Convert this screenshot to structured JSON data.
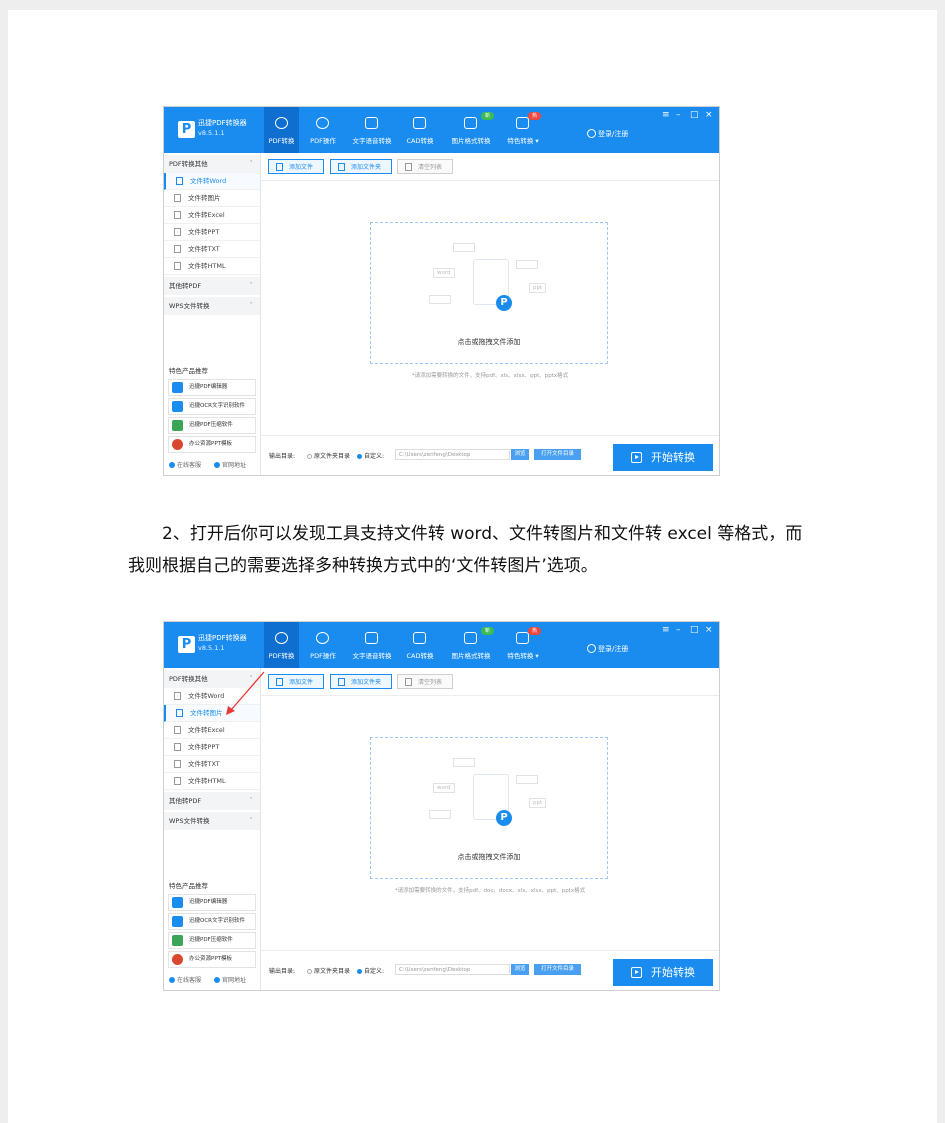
{
  "paragraph": {
    "line1": "2、打开后你可以发现工具支持文件转 word、文件转图片和文件转 excel 等格式，而",
    "line2": "我则根据自己的需要选择多种转换方式中的‘文件转图片’选项。"
  },
  "app": {
    "name": "迅捷PDF转换器",
    "version": "v8.5.1.1",
    "logo_letter": "P",
    "nav": [
      {
        "label": "PDF转换",
        "icon": "refresh-icon",
        "active": true
      },
      {
        "label": "PDF操作",
        "icon": "gear-icon"
      },
      {
        "label": "文字语音转换",
        "icon": "audio-icon"
      },
      {
        "label": "CAD转换",
        "icon": "cad-icon"
      },
      {
        "label": "图片格式转换",
        "icon": "image-icon",
        "badge": "新"
      },
      {
        "label": "特色转换 ▾",
        "icon": "camera-icon",
        "badge": "热"
      }
    ],
    "login": "登录/注册",
    "window_controls": [
      "≡",
      "–",
      "□",
      "×"
    ],
    "sidebar": {
      "section1": "PDF转换其他",
      "items": [
        "文件转Word",
        "文件转图片",
        "文件转Excel",
        "文件转PPT",
        "文件转TXT",
        "文件转HTML"
      ],
      "section2": "其他转PDF",
      "section3": "WPS文件转换",
      "featured_title": "特色产品推荐",
      "products": [
        "迅捷PDF编辑器",
        "迅捷OCR文字识别软件",
        "迅捷PDF压缩软件",
        "办公资源PPT模板"
      ],
      "footer_left": "在线客服",
      "footer_right": "官网地址"
    },
    "toolbar": {
      "add_file": "添加文件",
      "add_folder": "添加文件夹",
      "clear_list": "清空列表"
    },
    "dropzone": {
      "text": "点击或拖拽文件添加",
      "chips": [
        "word",
        "ppt"
      ]
    },
    "bottom": {
      "output_label": "输出目录:",
      "source_dir": "原文件夹目录",
      "custom": "自定义:",
      "path": "C:\\Users\\zenfeng\\Desktop",
      "browse": "浏览",
      "open_folder": "打开文件目录",
      "start": "开始转换"
    }
  },
  "screens": [
    {
      "active_item_index": 0,
      "hint": "*请添加需要转换的文件，支持pdf、xls、xlsx、ppt、pptx格式"
    },
    {
      "active_item_index": 1,
      "hint": "*请添加需要转换的文件，支持pdf、doc、docx、xls、xlsx、ppt、pptx格式"
    }
  ],
  "colors": {
    "accent": "#1a8cf0",
    "arrow": "#e53935"
  }
}
